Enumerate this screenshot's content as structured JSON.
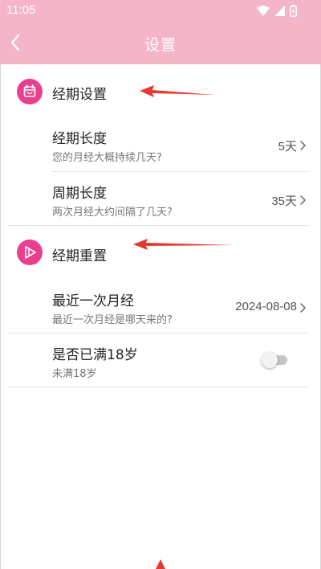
{
  "status_bar": {
    "time": "11:05",
    "icons": [
      "wifi-icon",
      "signal-icon",
      "battery-icon"
    ]
  },
  "header": {
    "title": "设置",
    "back_icon": "chevron-left-icon",
    "background_color": "#f5b5c9"
  },
  "sections": [
    {
      "title": "经期设置",
      "icon": "calendar-icon",
      "rows": [
        {
          "title": "经期长度",
          "subtitle": "您的月经大概持续几天?",
          "value": "5天"
        },
        {
          "title": "周期长度",
          "subtitle": "两次月经大约间隔了几天?",
          "value": "35天"
        }
      ]
    },
    {
      "title": "经期重置",
      "icon": "play-icon",
      "rows": [
        {
          "title": "最近一次月经",
          "subtitle": "最近一次月经是哪天来的?",
          "value": "2024-08-08"
        },
        {
          "title": "是否已满18岁",
          "subtitle": "未满18岁",
          "toggle_on": false
        }
      ]
    }
  ],
  "colors": {
    "accent": "#ea3f8f",
    "annotation_arrow": "#e53935"
  }
}
